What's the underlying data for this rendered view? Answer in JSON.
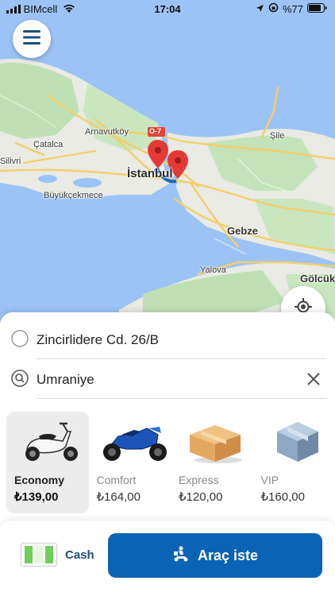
{
  "status_bar": {
    "carrier": "BIMcell",
    "time": "17:04",
    "battery": "%77"
  },
  "map": {
    "labels": {
      "arnavutkoy": "Arnavutköy",
      "catalca": "Çatalca",
      "sile": "Şile",
      "silivri": "Silivri",
      "istanbul": "İstanbul",
      "buyukcekmece": "Büyükçekmece",
      "gebze": "Gebze",
      "yalova": "Yalova",
      "golcuk": "Gölcük",
      "road_o7": "O-7"
    },
    "colors": {
      "sea": "#9cc3f5",
      "land": "#e8eae3",
      "green": "#bfe0b5",
      "road": "#f3cf6b",
      "pin": "#e53935"
    }
  },
  "origin": {
    "label": "Zincirlidere Cd. 26/B"
  },
  "destination": {
    "label": "Umraniye"
  },
  "vehicles": [
    {
      "name": "Economy",
      "price": "₺139,00",
      "selected": true,
      "icon": "scooter-icon"
    },
    {
      "name": "Comfort",
      "price": "₺164,00",
      "selected": false,
      "icon": "motorcycle-icon"
    },
    {
      "name": "Express",
      "price": "₺120,00",
      "selected": false,
      "icon": "package-icon"
    },
    {
      "name": "VIP",
      "price": "₺160,00",
      "selected": false,
      "icon": "vip-box-icon"
    }
  ],
  "payment": {
    "label": "Cash",
    "icon": "cash-note-icon"
  },
  "request_button": {
    "label": "Araç iste",
    "icon": "courier-icon"
  },
  "accent_color": "#0b63b5"
}
